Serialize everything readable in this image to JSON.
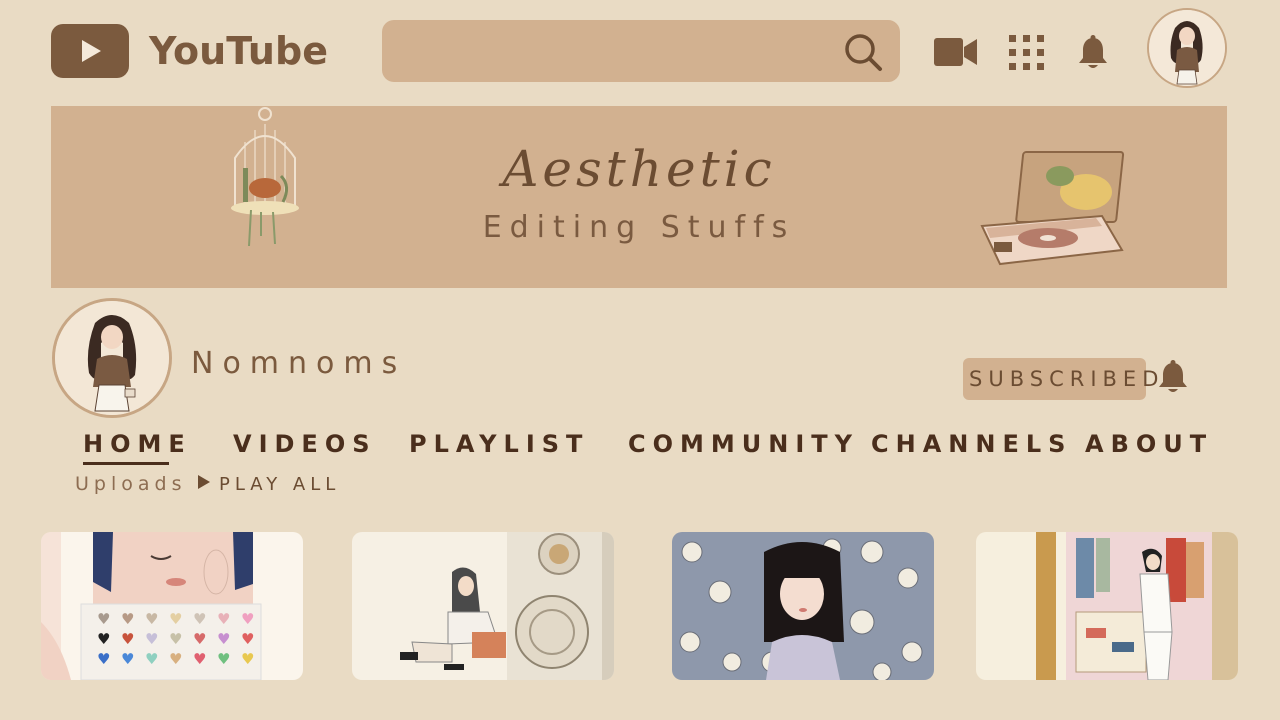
{
  "header": {
    "brand": "YouTube",
    "search": {
      "value": "",
      "placeholder": ""
    }
  },
  "banner": {
    "title": "Aesthetic",
    "subtitle": "Editing Stuffs"
  },
  "channel": {
    "name": "Nomnoms",
    "subscribe_label": "SUBSCRIBED"
  },
  "tabs": [
    {
      "label": "HOME",
      "active": true
    },
    {
      "label": "VIDEOS",
      "active": false
    },
    {
      "label": "PLAYLIST",
      "active": false
    },
    {
      "label": "COMMUNITY",
      "active": false
    },
    {
      "label": "CHANNELS",
      "active": false
    },
    {
      "label": "ABOUT",
      "active": false
    }
  ],
  "section": {
    "title": "Uploads",
    "play_all": "PLAY ALL"
  },
  "icons": {
    "logo": "play-icon",
    "search": "search-icon",
    "create": "video-camera-icon",
    "apps": "apps-grid-icon",
    "notifications": "bell-icon",
    "subscription_bell": "bell-icon"
  },
  "colors": {
    "background": "#e9dbc4",
    "panel": "#d2b190",
    "accent_dark": "#7b5a3e",
    "text_dark": "#4a2e1c"
  }
}
